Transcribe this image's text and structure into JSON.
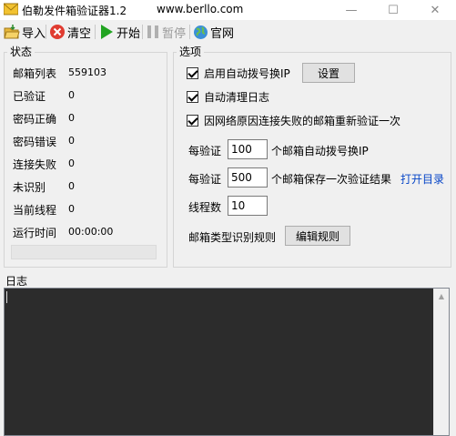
{
  "window": {
    "title": "伯勒发件箱验证器1.2",
    "url": "www.berllo.com",
    "minimize": "—",
    "maximize": "☐",
    "close": "✕"
  },
  "toolbar": {
    "import": "导入",
    "clear": "清空",
    "start": "开始",
    "pause": "暂停",
    "website": "官网"
  },
  "status": {
    "title": "状态",
    "rows": [
      {
        "label": "邮箱列表",
        "value": "559103"
      },
      {
        "label": "已验证",
        "value": "0"
      },
      {
        "label": "密码正确",
        "value": "0"
      },
      {
        "label": "密码错误",
        "value": "0"
      },
      {
        "label": "连接失败",
        "value": "0"
      },
      {
        "label": "未识别",
        "value": "0"
      },
      {
        "label": "当前线程",
        "value": "0"
      },
      {
        "label": "运行时间",
        "value": "00:00:00"
      }
    ],
    "progress": 0
  },
  "options": {
    "title": "选项",
    "auto_dial": {
      "label": "启用自动拨号换IP",
      "checked": true
    },
    "settings_button": "设置",
    "auto_clear_log": {
      "label": "自动清理日志",
      "checked": true
    },
    "reverify_on_network_fail": {
      "label": "因网络原因连接失败的邮箱重新验证一次",
      "checked": true
    },
    "dial_every": {
      "prefix": "每验证",
      "value": "100",
      "suffix": "个邮箱自动拨号换IP"
    },
    "save_every": {
      "prefix": "每验证",
      "value": "500",
      "suffix": "个邮箱保存一次验证结果"
    },
    "open_dir_link": "打开目录",
    "threads": {
      "label": "线程数",
      "value": "10"
    },
    "rule": {
      "label": "邮箱类型识别规则",
      "button": "编辑规则"
    }
  },
  "log": {
    "title": "日志"
  },
  "colors": {
    "log_background": "#2c2c2c",
    "link": "#0645c7",
    "start_icon": "#22a422"
  }
}
